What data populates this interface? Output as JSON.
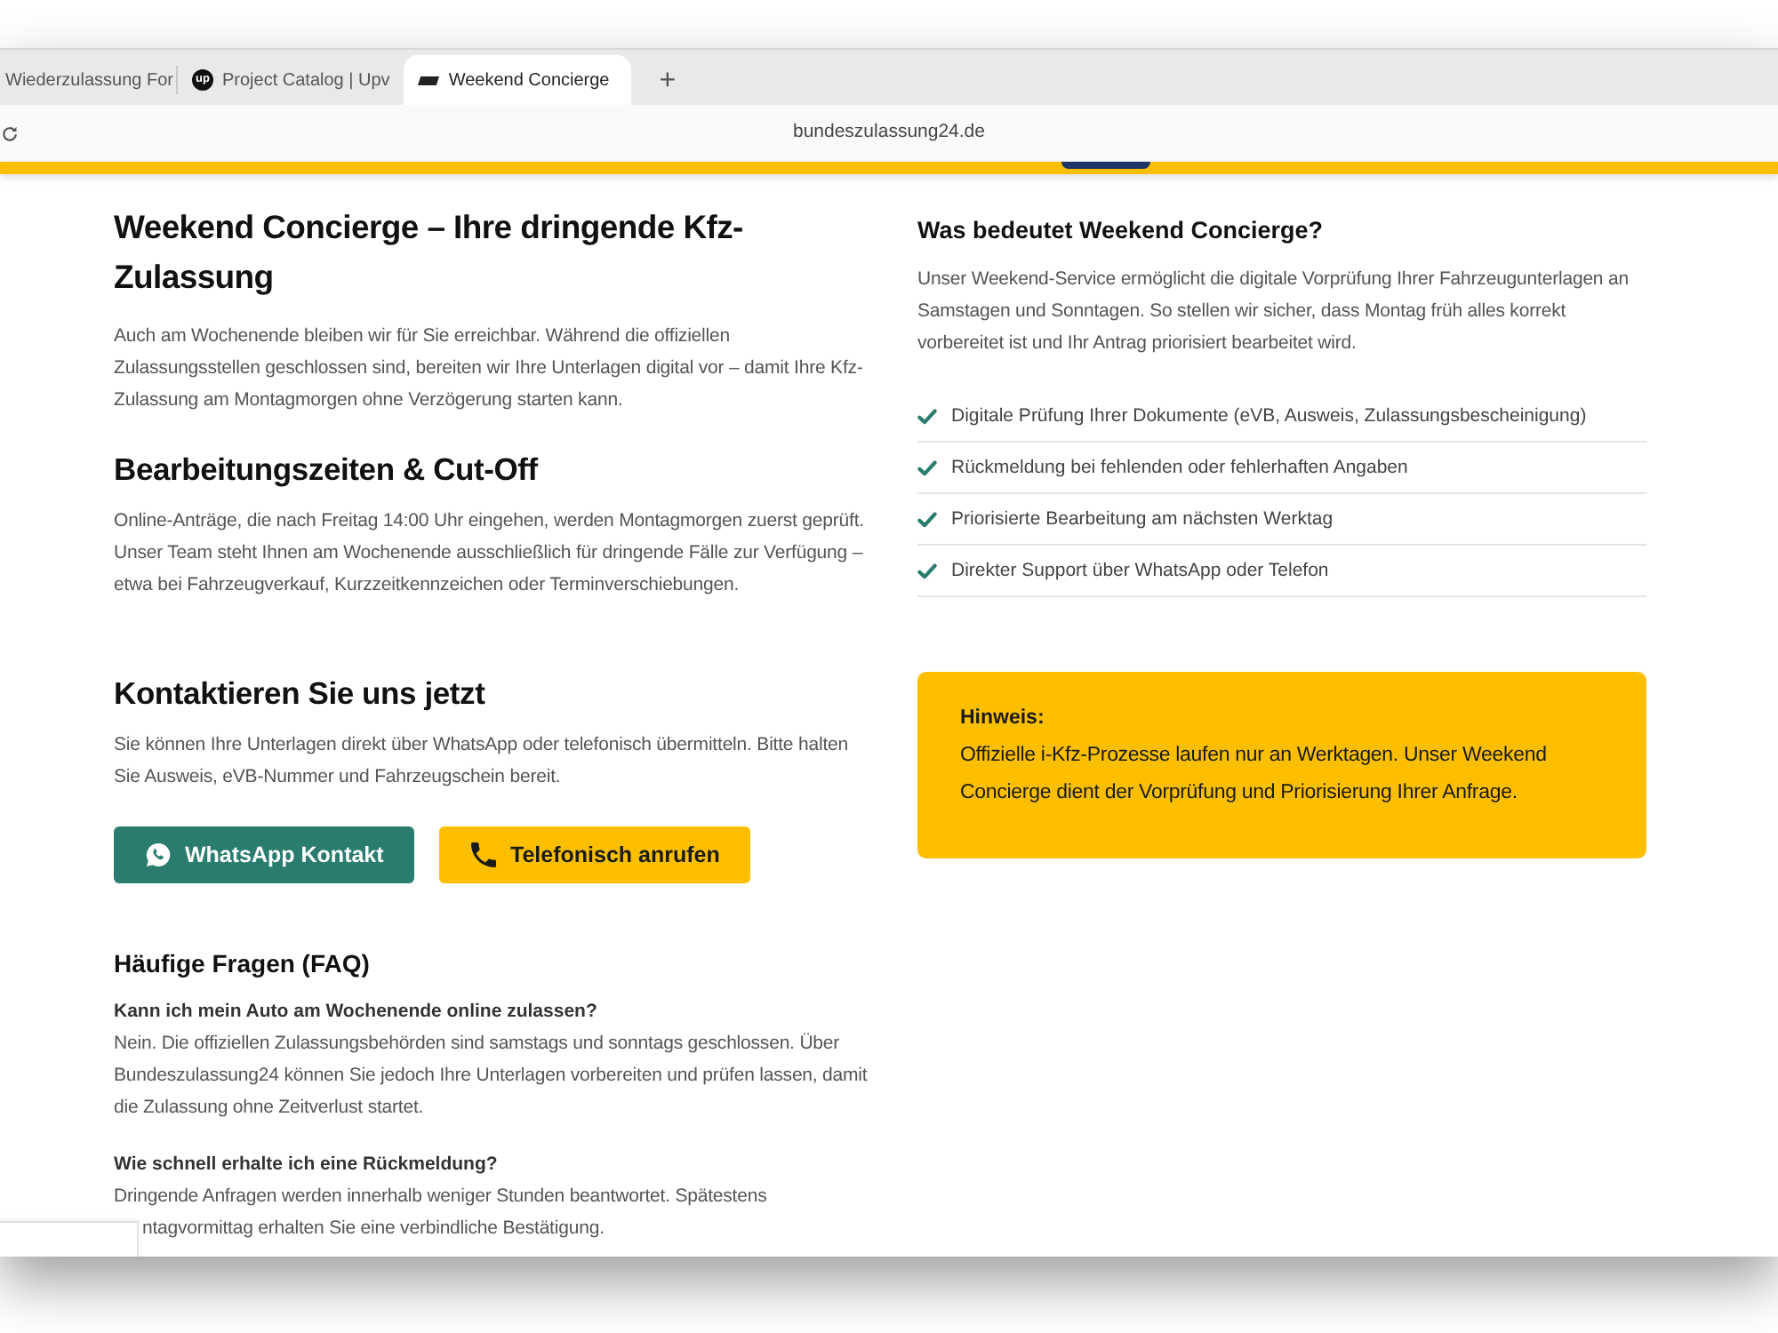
{
  "browser": {
    "tabs": [
      {
        "title": "Wiederzulassung For",
        "selected": false,
        "kind": "plain"
      },
      {
        "title": "Project Catalog | Upv",
        "selected": false,
        "kind": "logo",
        "logo_text": "up"
      },
      {
        "title": "Weekend Concierge",
        "selected": true,
        "kind": "plate"
      }
    ],
    "new_tab": "+",
    "url": "bundeszulassung24.de"
  },
  "intro": {
    "title": "Weekend Concierge – Ihre dringende Kfz-Zulassung",
    "text": "Auch am Wochenende bleiben wir für Sie erreichbar. Während die offiziellen Zulassungsstellen geschlossen sind, bereiten wir Ihre Unterlagen digital vor – damit Ihre Kfz-Zulassung am Montagmorgen ohne Verzögerung starten kann."
  },
  "hours": {
    "title": "Bearbeitungszeiten & Cut-Off",
    "text": "Online-Anträge, die nach Freitag 14:00 Uhr eingehen, werden Montagmorgen zuerst geprüft. Unser Team steht Ihnen am Wochenende ausschließlich für dringende Fälle zur Verfügung – etwa bei Fahrzeugverkauf, Kurzzeitkennzeichen oder Terminverschiebungen."
  },
  "about": {
    "title": "Was bedeutet Weekend Concierge?",
    "text": "Unser Weekend-Service ermöglicht die digitale Vorprüfung Ihrer Fahrzeugunterlagen an Samstagen und Sonntagen. So stellen wir sicher, dass Montag früh alles korrekt vorbereitet ist und Ihr Antrag priorisiert bearbeitet wird.",
    "features": [
      "Digitale Prüfung Ihrer Dokumente (eVB, Ausweis, Zulassungsbescheinigung)",
      "Rückmeldung bei fehlenden oder fehlerhaften Angaben",
      "Priorisierte Bearbeitung am nächsten Werktag",
      "Direkter Support über WhatsApp oder Telefon"
    ]
  },
  "contact": {
    "title": "Kontaktieren Sie uns jetzt",
    "text": "Sie können Ihre Unterlagen direkt über WhatsApp oder telefonisch übermitteln. Bitte halten Sie Ausweis, eVB-Nummer und Fahrzeugschein bereit.",
    "buttons": [
      {
        "label": "WhatsApp Kontakt",
        "kind": "whatsapp"
      },
      {
        "label": "Telefonisch anrufen",
        "kind": "phone"
      }
    ]
  },
  "notice": {
    "title": "Hinweis:",
    "text": "Offizielle i-Kfz-Prozesse laufen nur an Werktagen. Unser Weekend Concierge dient der Vorprüfung und Priorisierung Ihrer Anfrage."
  },
  "faq": {
    "title": "Häufige Fragen (FAQ)",
    "items": [
      {
        "question": "Kann ich mein Auto am Wochenende online zulassen?",
        "answer": "Nein. Die offiziellen Zulassungsbehörden sind samstags und sonntags geschlossen. Über Bundeszulassung24 können Sie jedoch Ihre Unterlagen vorbereiten und prüfen lassen, damit die Zulassung ohne Zeitverlust startet."
      },
      {
        "question": "Wie schnell erhalte ich eine Rückmeldung?",
        "answer": "Dringende Anfragen werden innerhalb weniger Stunden beantwortet. Spätestens",
        "answer_cut": "ntagvormittag erhalten Sie eine verbindliche Bestätigung."
      }
    ]
  }
}
